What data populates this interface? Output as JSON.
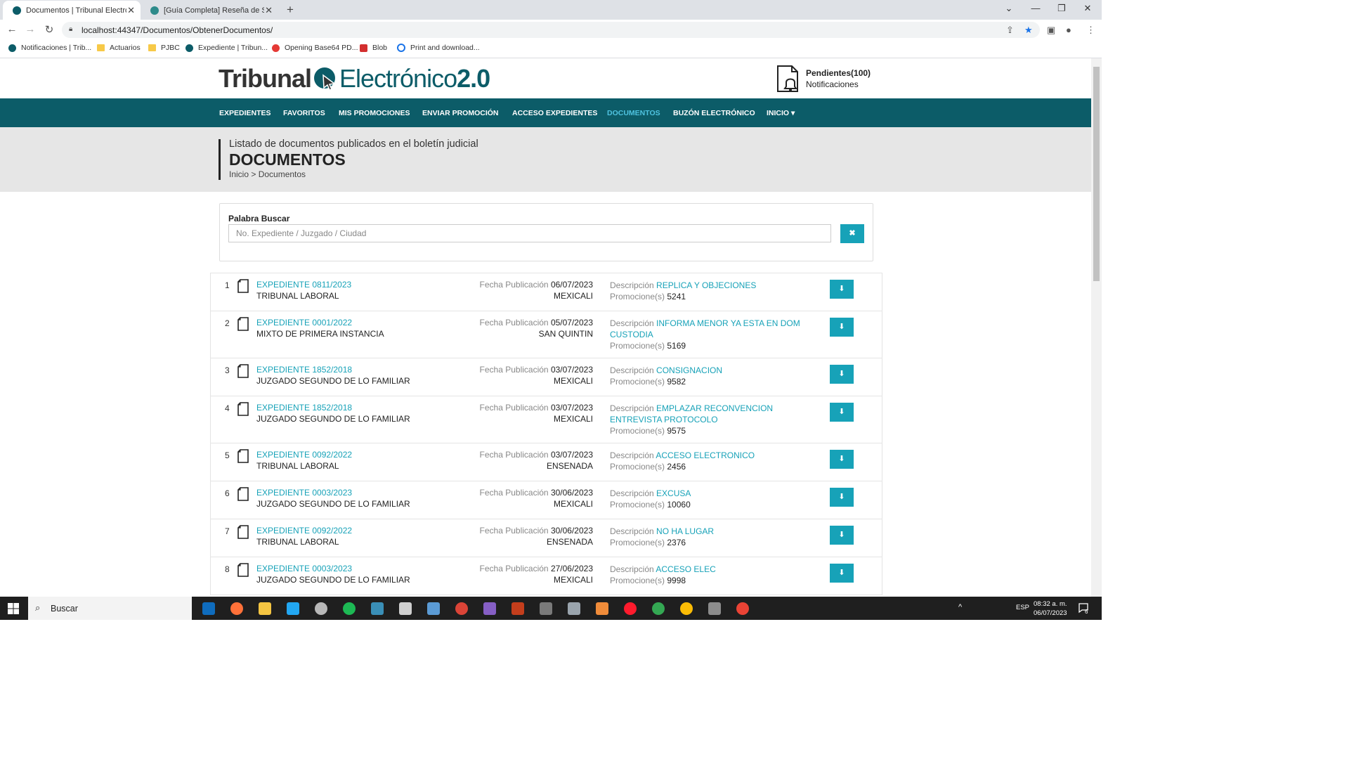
{
  "browser": {
    "tabs": [
      {
        "title": "Documentos | Tribunal Electrónic",
        "close": "✕",
        "favicon_color": "#0c5c68"
      },
      {
        "title": "[Guía Completa] Reseña de Share",
        "close": "✕",
        "favicon_color": "#2e8b8b"
      }
    ],
    "new_tab": "+",
    "window_controls": {
      "dropdown": "⌄",
      "minimize": "—",
      "restore": "❐",
      "close": "✕"
    },
    "nav": {
      "back": "←",
      "forward": "→",
      "reload": "↻"
    },
    "url": "localhost:44347/Documentos/ObtenerDocumentos/",
    "bookmarks": [
      {
        "label": "Notificaciones | Trib...",
        "icon": "tribunal-icon",
        "kind": "site"
      },
      {
        "label": "Actuarios",
        "icon": "folder-icon",
        "kind": "folder"
      },
      {
        "label": "PJBC",
        "icon": "folder-icon",
        "kind": "folder"
      },
      {
        "label": "Expediente | Tribun...",
        "icon": "tribunal-icon",
        "kind": "site"
      },
      {
        "label": "Opening Base64 PD...",
        "icon": "opera-icon",
        "kind": "site"
      },
      {
        "label": "Blob",
        "icon": "figure-icon",
        "kind": "site"
      },
      {
        "label": "Print and download...",
        "icon": "print-icon",
        "kind": "site"
      }
    ]
  },
  "site": {
    "logo": {
      "part1": "Tribunal",
      "part2": "Electrónico",
      "part3": "2.0"
    },
    "notifications": {
      "pending": "Pendientes(100)",
      "label": "Notificaciones"
    },
    "nav": [
      {
        "label": "EXPEDIENTES",
        "current": false
      },
      {
        "label": "FAVORITOS",
        "current": false
      },
      {
        "label": "MIS PROMOCIONES",
        "current": false
      },
      {
        "label": "ENVIAR PROMOCIÓN",
        "current": false
      },
      {
        "label": "ACCESO EXPEDIENTES",
        "current": false
      },
      {
        "label": "DOCUMENTOS",
        "current": true
      },
      {
        "label": "BUZÓN ELECTRÓNICO",
        "current": false
      },
      {
        "label": "INICIO ▾",
        "current": false
      }
    ],
    "hero": {
      "subtitle": "Listado de documentos publicados en el boletín judicial",
      "title": "DOCUMENTOS",
      "breadcrumb": "Inicio > Documentos"
    },
    "search": {
      "label": "Palabra Buscar",
      "placeholder": "No. Expediente / Juzgado / Ciudad",
      "value": "",
      "clear": "✖"
    },
    "labels": {
      "pub": "Fecha Publicación",
      "desc": "Descripción",
      "promo": "Promocione(s)",
      "download": "⬇"
    },
    "documents": [
      {
        "n": "1",
        "expediente": "EXPEDIENTE 0811/2023",
        "court": "TRIBUNAL LABORAL",
        "date": "06/07/2023",
        "city": "MEXICALI",
        "desc": "REPLICA Y OBJECIONES",
        "promo": "5241",
        "lines": 2
      },
      {
        "n": "2",
        "expediente": "EXPEDIENTE 0001/2022",
        "court": "MIXTO DE PRIMERA INSTANCIA",
        "date": "05/07/2023",
        "city": "SAN QUINTIN",
        "desc": "INFORMA MENOR YA ESTA EN DOM CUSTODIA",
        "promo": "5169",
        "lines": 3
      },
      {
        "n": "3",
        "expediente": "EXPEDIENTE 1852/2018",
        "court": "JUZGADO SEGUNDO DE LO FAMILIAR",
        "date": "03/07/2023",
        "city": "MEXICALI",
        "desc": "CONSIGNACION",
        "promo": "9582",
        "lines": 2
      },
      {
        "n": "4",
        "expediente": "EXPEDIENTE 1852/2018",
        "court": "JUZGADO SEGUNDO DE LO FAMILIAR",
        "date": "03/07/2023",
        "city": "MEXICALI",
        "desc": "EMPLAZAR RECONVENCION ENTREVISTA PROTOCOLO",
        "promo": "9575",
        "lines": 3
      },
      {
        "n": "5",
        "expediente": "EXPEDIENTE 0092/2022",
        "court": "TRIBUNAL LABORAL",
        "date": "03/07/2023",
        "city": "ENSENADA",
        "desc": "ACCESO ELECTRONICO",
        "promo": "2456",
        "lines": 2
      },
      {
        "n": "6",
        "expediente": "EXPEDIENTE 0003/2023",
        "court": "JUZGADO SEGUNDO DE LO FAMILIAR",
        "date": "30/06/2023",
        "city": "MEXICALI",
        "desc": "EXCUSA",
        "promo": "10060",
        "lines": 2
      },
      {
        "n": "7",
        "expediente": "EXPEDIENTE 0092/2022",
        "court": "TRIBUNAL LABORAL",
        "date": "30/06/2023",
        "city": "ENSENADA",
        "desc": "NO HA LUGAR",
        "promo": "2376",
        "lines": 2
      },
      {
        "n": "8",
        "expediente": "EXPEDIENTE 0003/2023",
        "court": "JUZGADO SEGUNDO DE LO FAMILIAR",
        "date": "27/06/2023",
        "city": "MEXICALI",
        "desc": "ACCESO ELEC",
        "promo": "9998",
        "lines": 2
      }
    ]
  },
  "taskbar": {
    "search": "Buscar",
    "apps": [
      {
        "name": "outlook-icon",
        "color": "#0f6cbd"
      },
      {
        "name": "firefox-icon",
        "color": "#ff7139"
      },
      {
        "name": "file-explorer-icon",
        "color": "#f5c542"
      },
      {
        "name": "vscode-icon",
        "color": "#22a7f2"
      },
      {
        "name": "github-desktop-icon",
        "color": "#b8b8b8"
      },
      {
        "name": "spotify-icon",
        "color": "#1db954"
      },
      {
        "name": "app-teal-icon",
        "color": "#3a8fb7"
      },
      {
        "name": "settings-icon",
        "color": "#cfcfcf"
      },
      {
        "name": "window-app-icon",
        "color": "#5b9bd5"
      },
      {
        "name": "chrome-search-icon",
        "color": "#db4437"
      },
      {
        "name": "visual-studio-icon",
        "color": "#865fc5"
      },
      {
        "name": "powerpoint-icon",
        "color": "#c43e1c"
      },
      {
        "name": "calculator-icon",
        "color": "#7a7a7a"
      },
      {
        "name": "sql-icon",
        "color": "#9aa4ad"
      },
      {
        "name": "app-orange-icon",
        "color": "#f08c3a"
      },
      {
        "name": "opera-icon",
        "color": "#ff1b2d"
      },
      {
        "name": "chrome-icon",
        "color": "#34a853"
      },
      {
        "name": "chrome-active-icon",
        "color": "#fbbc05"
      },
      {
        "name": "remote-desktop-icon",
        "color": "#8c8c8c"
      },
      {
        "name": "chrome-canary-icon",
        "color": "#ea4335"
      }
    ],
    "tray": "^",
    "lang": "ESP",
    "time": "08:32 a. m.",
    "date": "06/07/2023",
    "notif_count": "6"
  }
}
